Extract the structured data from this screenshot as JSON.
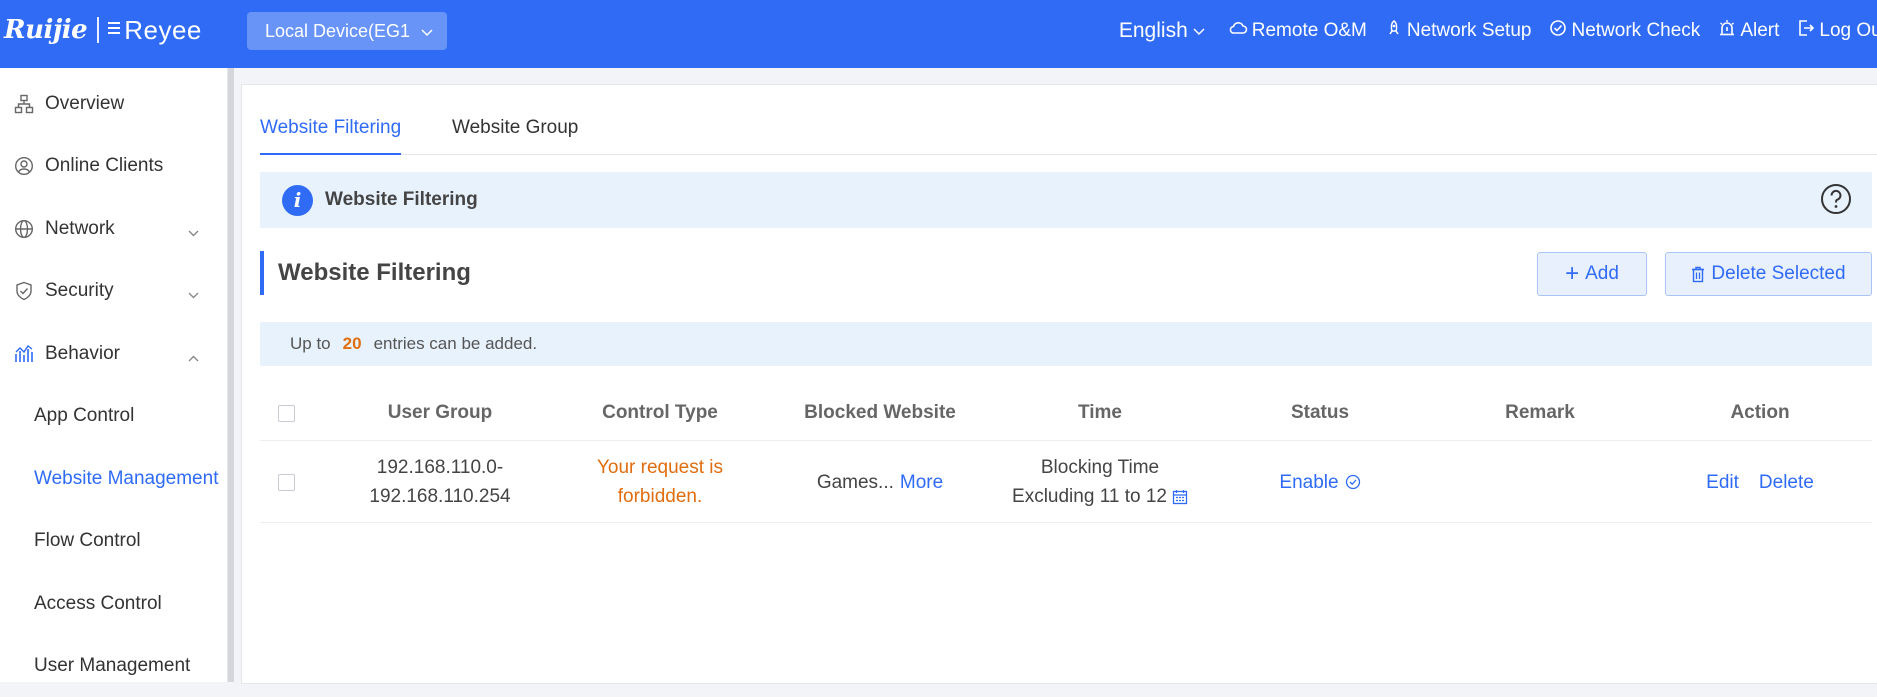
{
  "header": {
    "logo_ruijie": "Ruijie",
    "logo_reyee": "Reyee",
    "device_select": "Local Device(EG1",
    "language": "English",
    "nav": [
      {
        "label": "Remote O&M",
        "icon": "cloud-icon"
      },
      {
        "label": "Network Setup",
        "icon": "rocket-icon"
      },
      {
        "label": "Network Check",
        "icon": "check-circle-icon"
      },
      {
        "label": "Alert",
        "icon": "alert-icon"
      },
      {
        "label": "Log Out",
        "icon": "logout-icon"
      }
    ]
  },
  "sidebar": {
    "items": [
      {
        "label": "Overview",
        "icon": "topology-icon"
      },
      {
        "label": "Online Clients",
        "icon": "user-circle-icon"
      },
      {
        "label": "Network",
        "icon": "globe-icon"
      },
      {
        "label": "Security",
        "icon": "shield-icon"
      },
      {
        "label": "Behavior",
        "icon": "chart-icon"
      }
    ],
    "sub_items": [
      {
        "label": "App Control"
      },
      {
        "label": "Website Management"
      },
      {
        "label": "Flow Control"
      },
      {
        "label": "Access Control"
      },
      {
        "label": "User Management"
      }
    ]
  },
  "main": {
    "tabs": [
      {
        "label": "Website Filtering"
      },
      {
        "label": "Website Group"
      }
    ],
    "info_title": "Website Filtering",
    "section_title": "Website Filtering",
    "add_label": "Add",
    "delete_selected_label": "Delete Selected",
    "limit": {
      "prefix": "Up to",
      "count": "20",
      "suffix": "entries can be added."
    }
  },
  "table": {
    "columns": [
      "User Group",
      "Control Type",
      "Blocked Website",
      "Time",
      "Status",
      "Remark",
      "Action"
    ],
    "rows": [
      {
        "user_group_line1": "192.168.110.0-",
        "user_group_line2": "192.168.110.254",
        "control_type_line1": "Your request is",
        "control_type_line2": "forbidden.",
        "blocked_website": "Games...",
        "blocked_more": "More",
        "time_line1": "Blocking Time",
        "time_line2": "Excluding 11 to 12",
        "status": "Enable",
        "remark": "",
        "action_edit": "Edit",
        "action_delete": "Delete"
      }
    ]
  },
  "colors": {
    "brand": "#2f6bf5",
    "warning": "#e06d10",
    "info_bg": "#e8f2fd"
  }
}
